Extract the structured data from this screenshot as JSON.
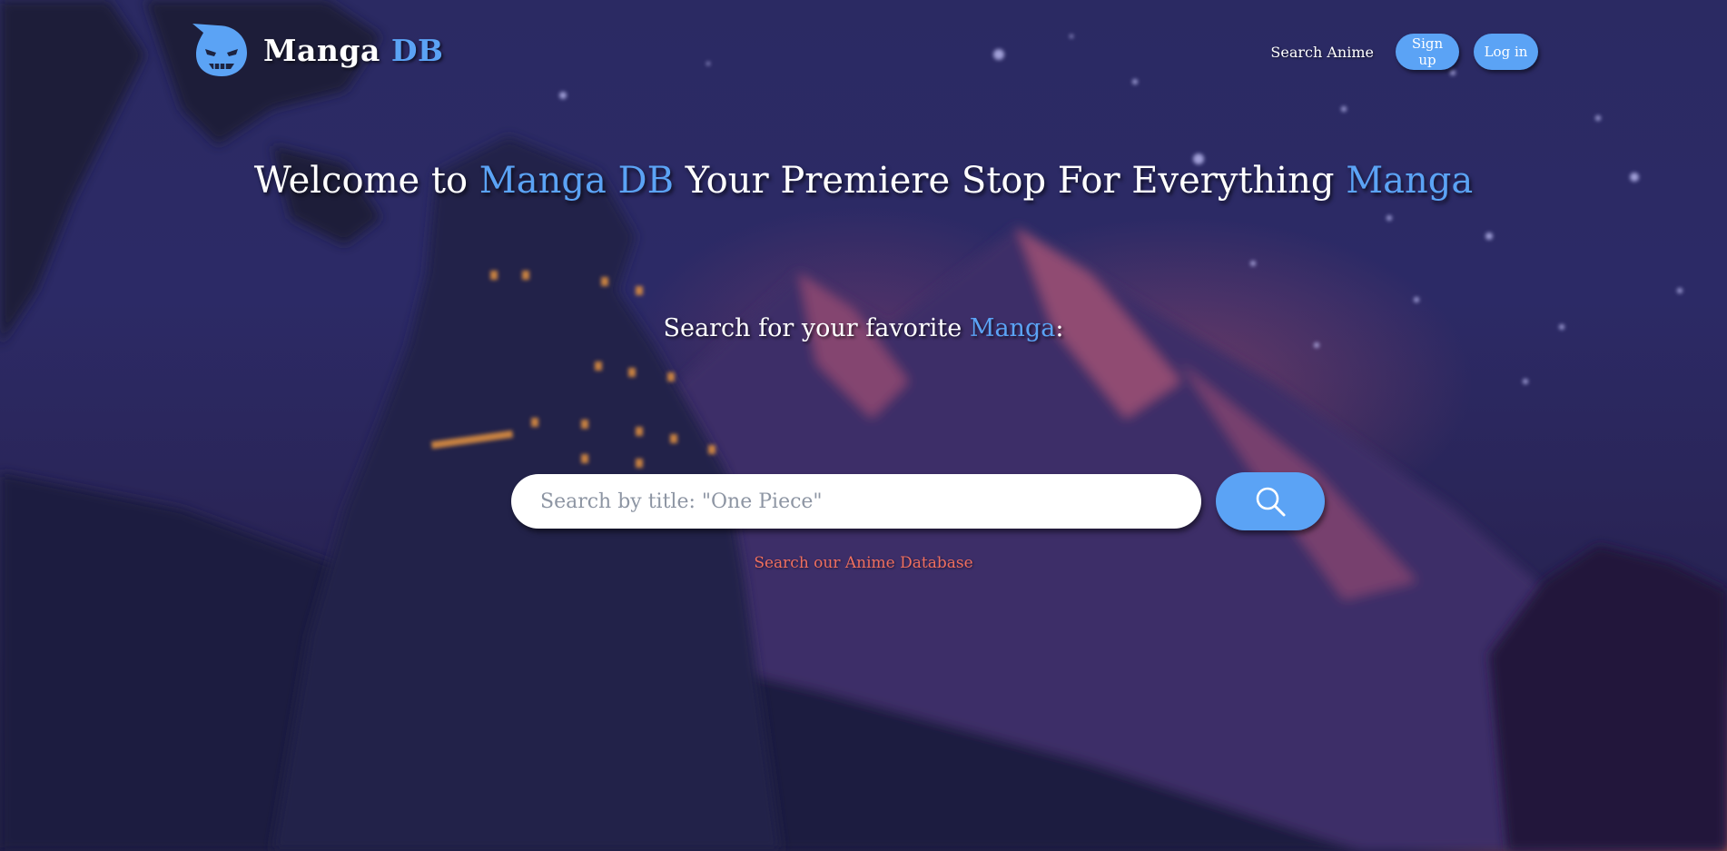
{
  "brand": {
    "name_part1": "Manga",
    "name_part2": "DB",
    "logo_icon": "masked-face-logo-icon",
    "accent_color": "#5ba3f5"
  },
  "nav": {
    "search_anime": "Search Anime",
    "signup": "Sign up",
    "login": "Log in"
  },
  "hero": {
    "welcome_prefix": "Welcome to",
    "welcome_brand": "Manga DB",
    "welcome_middle": "Your Premiere Stop For Everything",
    "welcome_suffix": "Manga"
  },
  "search": {
    "heading_prefix": "Search for your favorite",
    "heading_accent": "Manga",
    "heading_suffix": ":",
    "placeholder": "Search by title: \"One Piece\"",
    "button_icon": "search-icon",
    "alt_link": "Search our Anime Database",
    "alt_link_color": "#ef6f5e"
  }
}
